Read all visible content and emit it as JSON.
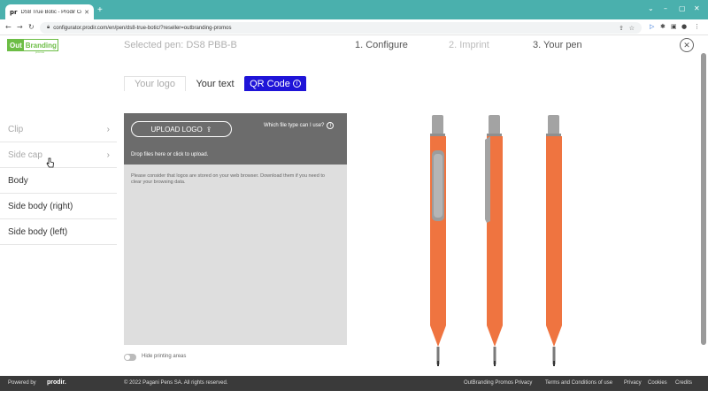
{
  "browser": {
    "tab_title": "DS8 True Botic - Prodir Configu...",
    "tab_favicon": "pr",
    "url": "configurator.prodir.com/en/pen/ds8-true-botic/?reseller=outbranding-promos",
    "icons": [
      "back-arrow-icon",
      "forward-arrow-icon",
      "reload-icon",
      "lock-icon",
      "share-icon",
      "star-icon",
      "extension-icon",
      "puzzle-icon",
      "sidebar-icon",
      "profile-icon",
      "menu-icon"
    ]
  },
  "header": {
    "logo_part1": "Out",
    "logo_part2": "Branding",
    "logo_sub": "promos",
    "selected_pen": "Selected pen: DS8 PBB-B",
    "steps": [
      "1. Configure",
      "2. Imprint",
      "3. Your pen"
    ]
  },
  "tabs": {
    "logo": "Your logo",
    "text": "Your text",
    "qr": "QR Code"
  },
  "sidebar": {
    "items": [
      {
        "label": "Clip",
        "dim": true,
        "chevron": true
      },
      {
        "label": "Side cap",
        "dim": true,
        "chevron": true
      },
      {
        "label": "Body",
        "dim": false,
        "chevron": false
      },
      {
        "label": "Side body (right)",
        "dim": false,
        "chevron": false
      },
      {
        "label": "Side body (left)",
        "dim": false,
        "chevron": false
      }
    ]
  },
  "upload": {
    "button": "UPLOAD LOGO",
    "filetype_question": "Which file type can I use?",
    "drop_text": "Drop files here or click to upload.",
    "note": "Please consider that logos are stored on your web browser. Download them if you need to clear your browsing data."
  },
  "toggle_label": "Hide printing areas",
  "colors": {
    "accent": "#1f14d8",
    "pen_body": "#ef7440",
    "pen_metal": "#9c9c9c",
    "brand_green": "#6cbd45",
    "browser_tabstrip": "#4ab0ad"
  },
  "footer": {
    "powered_by": "Powered by",
    "brand": "prodir.",
    "copyright": "© 2022 Pagani Pens SA. All rights reserved.",
    "links": [
      "OutBranding Promos Privacy",
      "Terms and Conditions of use",
      "Privacy",
      "Cookies",
      "Credits"
    ]
  }
}
